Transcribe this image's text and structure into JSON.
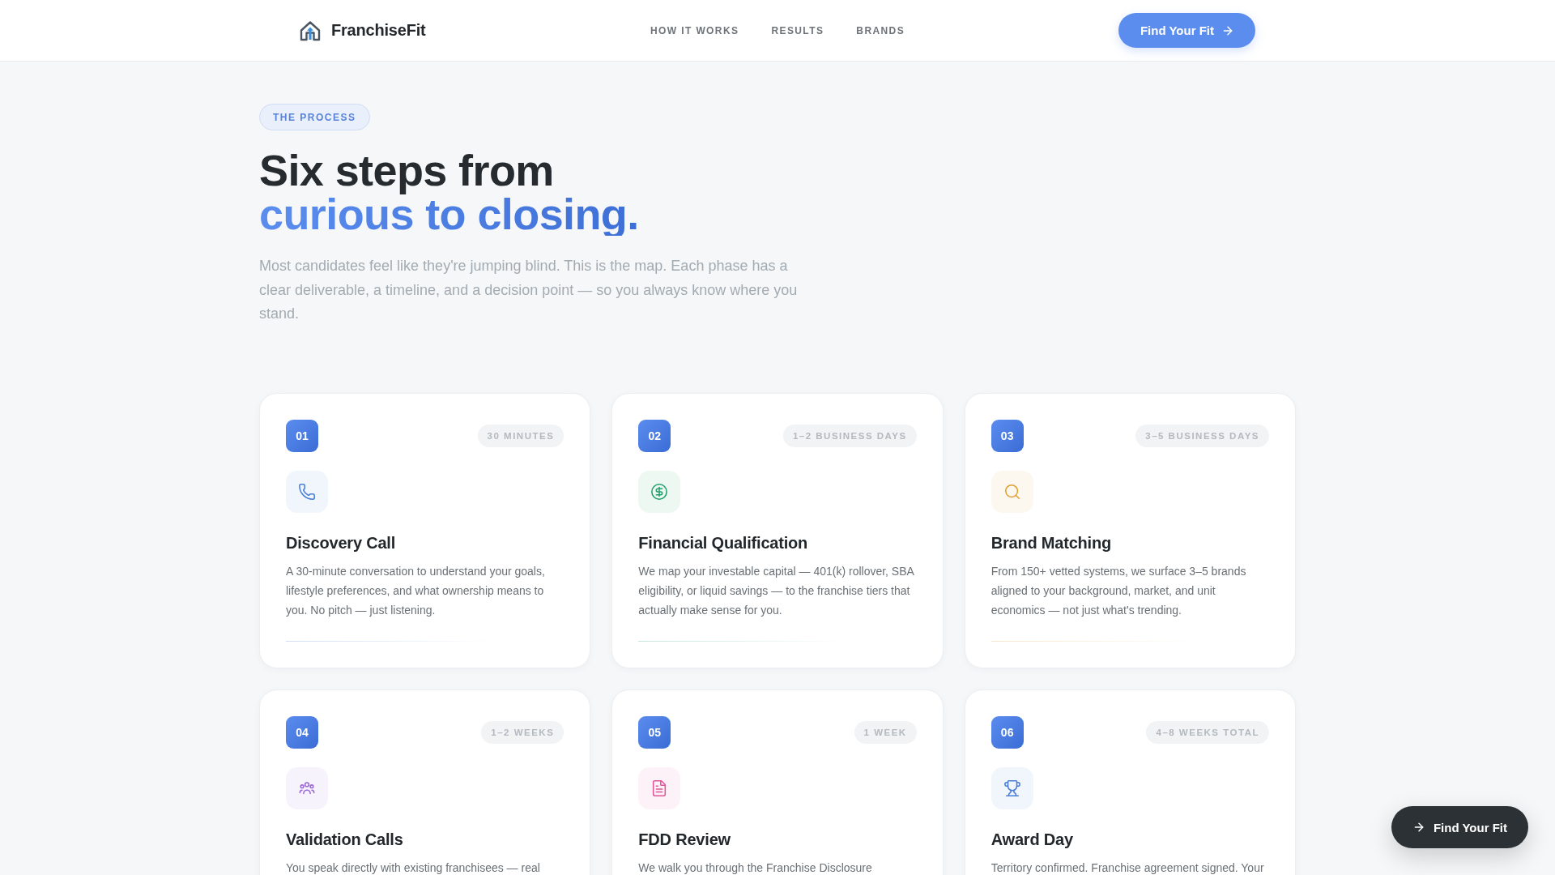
{
  "header": {
    "brand": "FranchiseFit",
    "nav": [
      "HOW IT WORKS",
      "RESULTS",
      "BRANDS"
    ],
    "cta": "Find Your Fit"
  },
  "hero": {
    "eyebrow": "THE PROCESS",
    "title_line_1": "Six steps from",
    "title_line_2": "curious to closing.",
    "intro": "Most candidates feel like they're jumping blind. This is the map. Each phase has a clear deliverable, a timeline, and a decision point — so you always know where you stand."
  },
  "steps": [
    {
      "number": "01",
      "duration": "30 MINUTES",
      "title": "Discovery Call",
      "description": "A 30-minute conversation to understand your goals, lifestyle preferences, and what ownership means to you. No pitch — just listening.",
      "color": "#4a7fd6"
    },
    {
      "number": "02",
      "duration": "1–2 BUSINESS DAYS",
      "title": "Financial Qualification",
      "description": "We map your investable capital — 401(k) rollover, SBA eligibility, or liquid savings — to the franchise tiers that actually make sense for you.",
      "color": "#22a06b"
    },
    {
      "number": "03",
      "duration": "3–5 BUSINESS DAYS",
      "title": "Brand Matching",
      "description": "From 150+ vetted systems, we surface 3–5 brands aligned to your background, market, and unit economics — not just what's trending.",
      "color": "#e0a030"
    },
    {
      "number": "04",
      "duration": "1–2 WEEKS",
      "title": "Validation Calls",
      "description": "You speak directly with existing franchisees — real",
      "color": "#9b6bd6"
    },
    {
      "number": "05",
      "duration": "1 WEEK",
      "title": "FDD Review",
      "description": "We walk you through the Franchise Disclosure",
      "color": "#e0559a"
    },
    {
      "number": "06",
      "duration": "4–8 WEEKS TOTAL",
      "title": "Award Day",
      "description": "Territory confirmed. Franchise agreement signed. Your",
      "color": "#4a7fd6"
    }
  ],
  "floating_button": {
    "label": "Find Your Fit"
  }
}
